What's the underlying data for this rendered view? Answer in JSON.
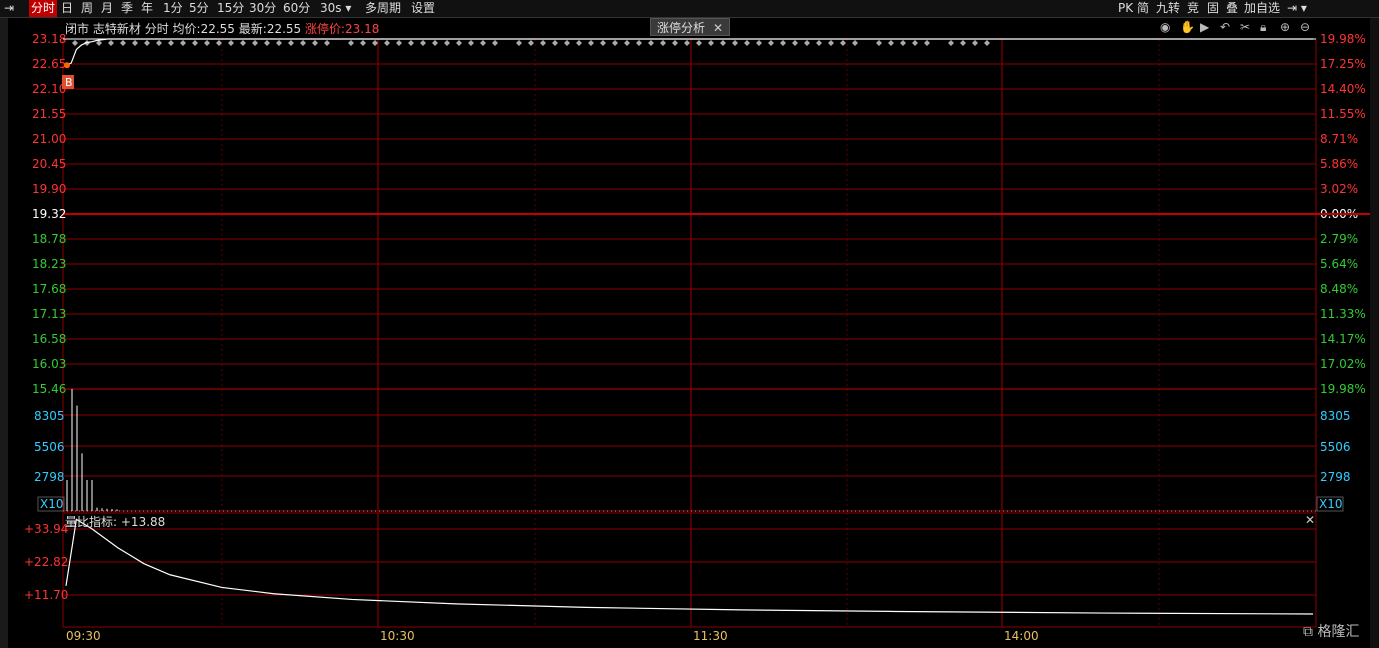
{
  "toolbar": {
    "left": [
      "分时",
      "日",
      "周",
      "月",
      "季",
      "年",
      "1分",
      "5分",
      "15分",
      "30分",
      "60分",
      "30s",
      "多周期",
      "设置"
    ],
    "right": [
      "PK",
      "简",
      "九转",
      "竞",
      "固",
      "叠",
      "加自选"
    ]
  },
  "info": {
    "status": "闭市",
    "name": "志特新材",
    "mode": "分时",
    "avg_label": "均价:",
    "avg_value": "22.55",
    "latest_label": "最新:",
    "latest_value": "22.55",
    "limit_label": "涨停价:",
    "limit_value": "23.18"
  },
  "zt_tab": {
    "label": "涨停分析",
    "close": "✕"
  },
  "indicator": {
    "label": "量比指标:",
    "value": "+13.88"
  },
  "badge_b": "B",
  "x10_label": "X10",
  "close_x": "✕",
  "watermark": "格隆汇",
  "colors": {
    "up": "#ff3333",
    "down": "#33cc33",
    "grid": "#8b0000",
    "vol": "#33ccff",
    "flat": "#ffffff"
  },
  "chart_data": {
    "type": "line",
    "price_axis": {
      "left": [
        "23.18",
        "22.65",
        "22.10",
        "21.55",
        "21.00",
        "20.45",
        "19.90",
        "19.32",
        "18.78",
        "18.23",
        "17.68",
        "17.13",
        "16.58",
        "16.03",
        "15.46"
      ],
      "right": [
        "19.98%",
        "17.25%",
        "14.40%",
        "11.55%",
        "8.71%",
        "5.86%",
        "3.02%",
        "0.00%",
        "2.79%",
        "5.64%",
        "8.48%",
        "11.33%",
        "14.17%",
        "17.02%",
        "19.98%"
      ],
      "ylim": [
        15.46,
        23.18
      ],
      "prev_close": 19.32
    },
    "volume_axis": {
      "left": [
        "8305",
        "5506",
        "2798"
      ],
      "right": [
        "8305",
        "5506",
        "2798"
      ],
      "ylim": [
        0,
        11000
      ]
    },
    "ratio_axis": {
      "ticks": [
        "+33.94",
        "+22.82",
        "+11.70"
      ],
      "ylim": [
        0,
        36
      ]
    },
    "time_axis": [
      "09:30",
      "10:30",
      "11:30",
      "14:00"
    ],
    "price_series": [
      [
        0,
        22.6
      ],
      [
        1,
        22.65
      ],
      [
        2,
        22.95
      ],
      [
        3,
        23.05
      ],
      [
        4,
        23.1
      ],
      [
        5,
        23.12
      ],
      [
        6,
        23.15
      ],
      [
        8,
        23.18
      ],
      [
        240,
        23.18
      ]
    ],
    "avg_series": [
      [
        0,
        22.55
      ],
      [
        240,
        22.55
      ]
    ],
    "volume": [
      [
        0,
        2800
      ],
      [
        1,
        11000
      ],
      [
        2,
        9500
      ],
      [
        3,
        5200
      ],
      [
        4,
        2800
      ],
      [
        5,
        2800
      ],
      [
        6,
        300
      ],
      [
        7,
        250
      ],
      [
        8,
        200
      ],
      [
        9,
        180
      ],
      [
        10,
        150
      ]
    ],
    "ratio_series": [
      [
        0,
        13
      ],
      [
        2,
        34
      ],
      [
        5,
        31
      ],
      [
        10,
        25
      ],
      [
        15,
        20
      ],
      [
        20,
        16.5
      ],
      [
        30,
        12.5
      ],
      [
        40,
        10.5
      ],
      [
        55,
        8.7
      ],
      [
        75,
        7.3
      ],
      [
        100,
        6.2
      ],
      [
        130,
        5.4
      ],
      [
        160,
        4.9
      ],
      [
        200,
        4.4
      ],
      [
        240,
        4.1
      ]
    ]
  }
}
